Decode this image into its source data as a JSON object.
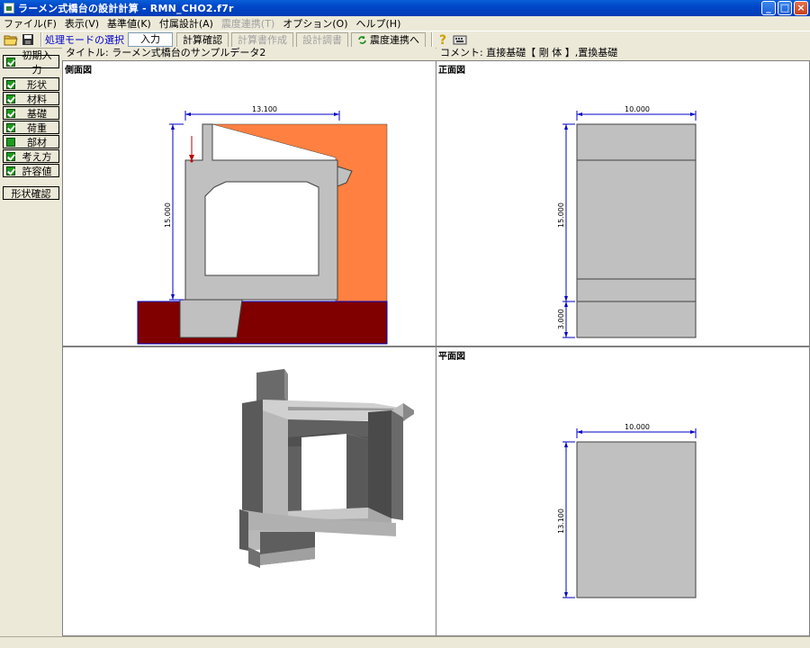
{
  "window": {
    "title": "ラーメン式橋台の設計計算 - RMN_CHO2.f7r"
  },
  "menu": [
    {
      "label": "ファイル(F)",
      "enabled": true
    },
    {
      "label": "表示(V)",
      "enabled": true
    },
    {
      "label": "基準値(K)",
      "enabled": true
    },
    {
      "label": "付属設計(A)",
      "enabled": true
    },
    {
      "label": "震度連携(T)",
      "enabled": false
    },
    {
      "label": "オプション(O)",
      "enabled": true
    },
    {
      "label": "ヘルプ(H)",
      "enabled": true
    }
  ],
  "toolbar": {
    "mode_label": "処理モードの選択",
    "mode_value": "入力",
    "calc_check": "計算確認",
    "report_create": "計算書作成",
    "design_report": "設計調書",
    "seismic_link": "震度連携へ"
  },
  "sidebar": {
    "initial_input": "初期入力",
    "items": [
      "形状",
      "材料",
      "基礎",
      "荷重",
      "部材",
      "考え方",
      "許容値"
    ],
    "shape_confirm": "形状確認"
  },
  "header": {
    "title_text": "タイトル: ラーメン式橋台のサンプルデータ2",
    "comment_text": "コメント: 直接基礎【 剛 体 】,置換基礎"
  },
  "views": {
    "side": {
      "label": "側面図",
      "dim_width": "13.100",
      "dim_height": "15.000"
    },
    "front": {
      "label": "正面図",
      "dim_width": "10.000",
      "dim_height": "15.000",
      "dim_footing": "3.000"
    },
    "plan": {
      "label": "平面図",
      "dim_width": "10.000",
      "dim_height": "13.100"
    }
  },
  "colors": {
    "backfill": "#ff8040",
    "ground": "#800000",
    "concrete": "#c0c0c0",
    "dimension": "#0000c8",
    "window_title": "#0a5fd8"
  },
  "icons": [
    "open-folder-icon",
    "save-disk-icon",
    "refresh-arrows-icon",
    "help-icon",
    "keyboard-icon"
  ]
}
